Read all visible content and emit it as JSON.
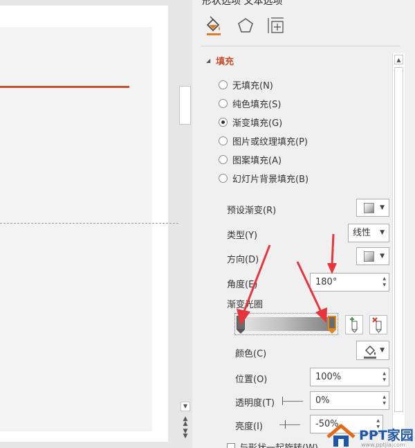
{
  "pane": {
    "title": "形状选项    文本选项",
    "tabs": [
      {
        "name": "fill-line",
        "icon": "paint-bucket-icon"
      },
      {
        "name": "effects",
        "icon": "pentagon-icon"
      },
      {
        "name": "size-properties",
        "icon": "size-layout-icon"
      }
    ],
    "section_header": "填充",
    "fill_options": [
      {
        "label": "无填充(N)",
        "selected": false
      },
      {
        "label": "纯色填充(S)",
        "selected": false
      },
      {
        "label": "渐变填充(G)",
        "selected": true
      },
      {
        "label": "图片或纹理填充(P)",
        "selected": false
      },
      {
        "label": "图案填充(A)",
        "selected": false
      },
      {
        "label": "幻灯片背景填充(B)",
        "selected": false
      }
    ],
    "preset_label": "预设渐变(R)",
    "type_label": "类型(Y)",
    "type_value": "线性",
    "direction_label": "方向(D)",
    "angle_label": "角度(E)",
    "angle_value": "180°",
    "stops_label": "渐变光圈",
    "color_label": "颜色(C)",
    "position_label": "位置(O)",
    "position_value": "100%",
    "transparency_label": "透明度(T)",
    "transparency_value": "0%",
    "brightness_label": "亮度(I)",
    "brightness_value": "-50%",
    "bottom_checkbox_label": "与形状一起旋转(W)"
  },
  "gradient": {
    "stops": [
      {
        "position": 0,
        "color": "#6a6a6a"
      },
      {
        "position": 100,
        "color": "#6a6a6a",
        "selected": true
      }
    ]
  },
  "colors": {
    "accent": "#c4502d",
    "selected_stop": "#e1861c",
    "annotation_arrow": "#e8343c"
  },
  "watermark": {
    "text": "PPT家园",
    "url": "www.pptjia.com"
  }
}
